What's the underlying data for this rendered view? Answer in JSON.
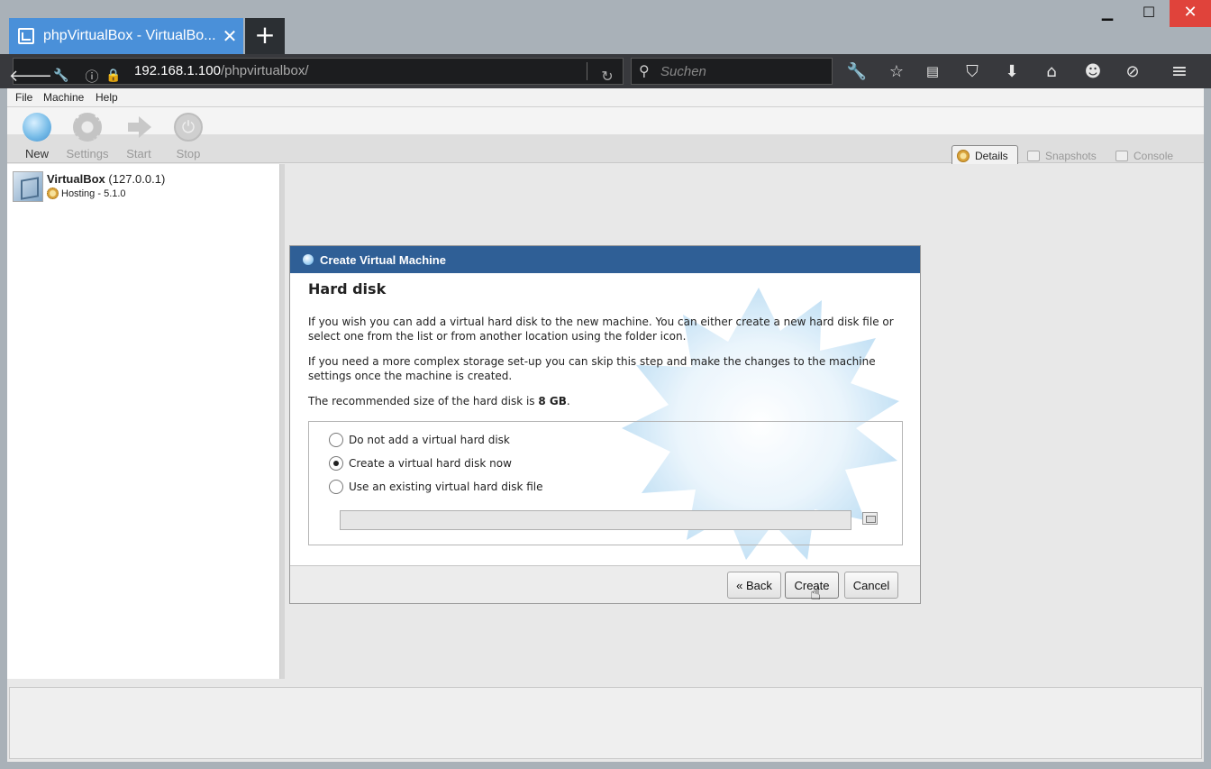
{
  "browser": {
    "tab_title": "phpVirtualBox - VirtualBo...",
    "new_tab_label": "+",
    "url_host": "192.168.1.100",
    "url_path": "/phpvirtualbox/",
    "search_placeholder": "Suchen"
  },
  "app": {
    "menu": [
      "File",
      "Machine",
      "Help"
    ],
    "toolbar": [
      {
        "label": "New",
        "icon": "new-vm-icon",
        "enabled": true
      },
      {
        "label": "Settings",
        "icon": "settings-gear-icon",
        "enabled": false
      },
      {
        "label": "Start",
        "icon": "start-arrow-icon",
        "enabled": false
      },
      {
        "label": "Stop",
        "icon": "power-icon",
        "enabled": false
      }
    ],
    "view_tabs": [
      "Details",
      "Snapshots",
      "Console"
    ],
    "host": {
      "name": "VirtualBox",
      "address": "(127.0.0.1)",
      "subtitle": "Hosting - 5.1.0"
    }
  },
  "dialog": {
    "title": "Create Virtual Machine",
    "heading": "Hard disk",
    "para1": "If you wish you can add a virtual hard disk to the new machine. You can either create a new hard disk file or select one from the list or from another location using the folder icon.",
    "para2": "If you need a more complex storage set-up you can skip this step and make the changes to the machine settings once the machine is created.",
    "recommend_prefix": "The recommended size of the hard disk is ",
    "recommend_value": "8 GB",
    "recommend_suffix": ".",
    "options": [
      {
        "label": "Do not add a virtual hard disk",
        "selected": false
      },
      {
        "label": "Create a virtual hard disk now",
        "selected": true
      },
      {
        "label": "Use an existing virtual hard disk file",
        "selected": false
      }
    ],
    "disk_file_value": "",
    "buttons": {
      "back": "« Back",
      "create": "Create",
      "cancel": "Cancel"
    }
  },
  "colors": {
    "tab_active": "#4a90d9",
    "dialog_header": "#2f5f96",
    "close_button": "#e0433b"
  }
}
